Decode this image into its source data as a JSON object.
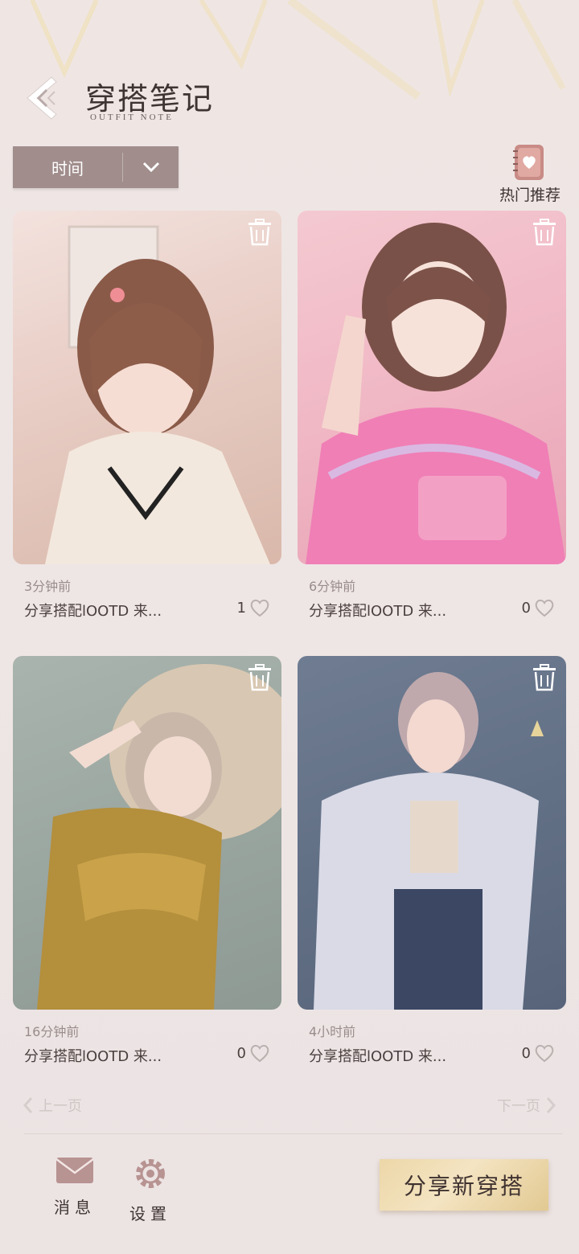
{
  "header": {
    "title": "穿搭笔记",
    "subtitle": "OUTFIT NOTE"
  },
  "sort": {
    "selected": "时间"
  },
  "hot": {
    "label": "热门推荐"
  },
  "cards": [
    {
      "time": "3分钟前",
      "caption": "分享搭配lOOTD 来...",
      "likes": "1"
    },
    {
      "time": "6分钟前",
      "caption": "分享搭配lOOTD 来...",
      "likes": "0"
    },
    {
      "time": "16分钟前",
      "caption": "分享搭配lOOTD 来...",
      "likes": "0"
    },
    {
      "time": "4小时前",
      "caption": "分享搭配lOOTD 来...",
      "likes": "0"
    }
  ],
  "pagination": {
    "prev": "上一页",
    "next": "下一页"
  },
  "bottom": {
    "messages": "消息",
    "settings": "设置",
    "share": "分享新穿搭"
  },
  "colors": {
    "accent": "#a08d8c",
    "gold": "#e9d3a0"
  }
}
